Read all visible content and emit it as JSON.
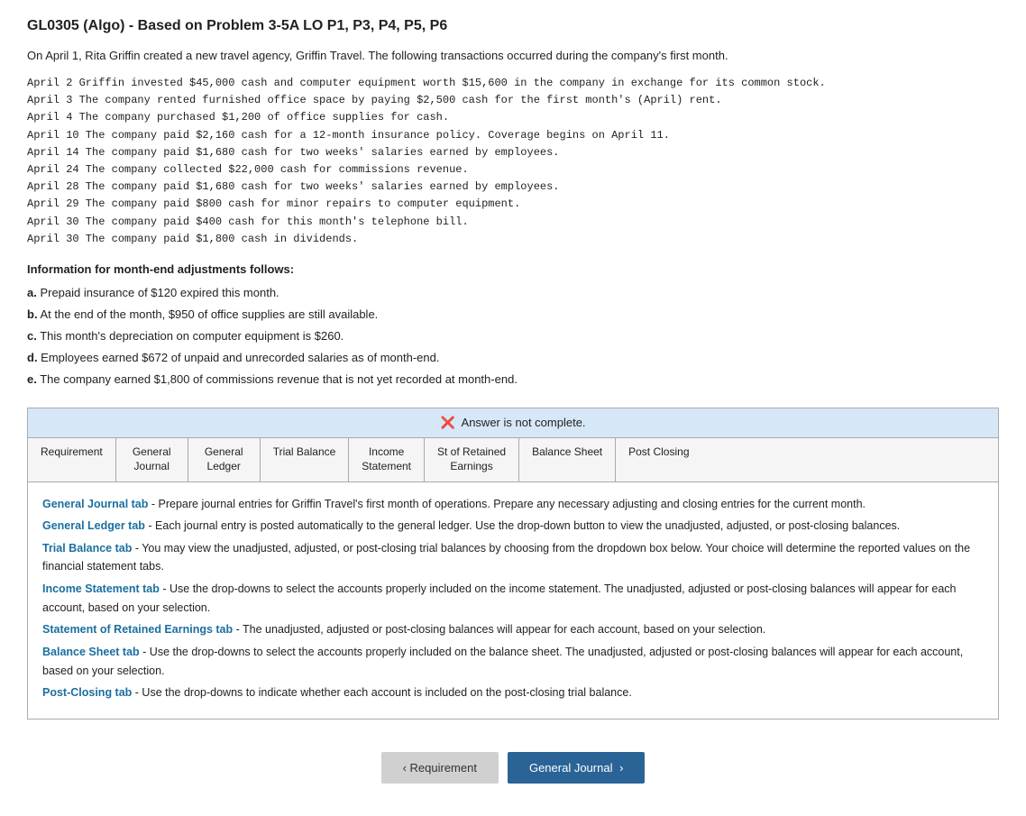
{
  "header": {
    "title": "GL0305 (Algo) - Based on Problem 3-5A LO P1, P3, P4, P5, P6"
  },
  "intro": "On April 1, Rita Griffin created a new travel agency, Griffin Travel. The following transactions occurred during the company's first month.",
  "transactions": [
    " April 2  Griffin invested $45,000 cash and computer equipment worth $15,600 in the company in exchange for its common stock.",
    " April 3  The company rented furnished office space by paying $2,500 cash for the first month's (April) rent.",
    " April 4  The company purchased $1,200 of office supplies for cash.",
    "April 10  The company paid $2,160 cash for a 12-month insurance policy. Coverage begins on April 11.",
    "April 14  The company paid $1,680 cash for two weeks' salaries earned by employees.",
    "April 24  The company collected $22,000 cash for commissions revenue.",
    "April 28  The company paid $1,680 cash for two weeks' salaries earned by employees.",
    "April 29  The company paid $800 cash for minor repairs to computer equipment.",
    "April 30  The company paid $400 cash for this month's telephone bill.",
    "April 30  The company paid $1,800 cash in dividends."
  ],
  "adjustments_title": "Information for month-end adjustments follows:",
  "adjustments": [
    {
      "label": "a.",
      "text": " Prepaid insurance of $120 expired this month.",
      "bold": false
    },
    {
      "label": "b.",
      "text": " At the end of the month, $950 of office supplies are still available.",
      "bold": true
    },
    {
      "label": "c.",
      "text": " This month's depreciation on computer equipment is $260.",
      "bold": false
    },
    {
      "label": "d.",
      "text": " Employees earned $672 of unpaid and unrecorded salaries as of month-end.",
      "bold": false
    },
    {
      "label": "e.",
      "text": " The company earned $1,800 of commissions revenue that is not yet recorded at month-end.",
      "bold": false
    }
  ],
  "answer_status": "Answer is not complete.",
  "tabs": [
    {
      "id": "requirement",
      "label": "Requirement"
    },
    {
      "id": "general-journal",
      "label": "General\nJournal"
    },
    {
      "id": "general-ledger",
      "label": "General\nLedger"
    },
    {
      "id": "trial-balance",
      "label": "Trial Balance"
    },
    {
      "id": "income-statement",
      "label": "Income\nStatement"
    },
    {
      "id": "st-retained-earnings",
      "label": "St of Retained\nEarnings"
    },
    {
      "id": "balance-sheet",
      "label": "Balance Sheet"
    },
    {
      "id": "post-closing",
      "label": "Post Closing"
    }
  ],
  "descriptions": [
    {
      "link_text": "General Journal tab",
      "body": " - Prepare journal entries for Griffin Travel's first month of operations.  Prepare any necessary adjusting and closing entries for the current month."
    },
    {
      "link_text": "General Ledger tab",
      "body": " - Each journal entry is posted automatically to the general ledger. Use the drop-down button to view the unadjusted, adjusted, or post-closing balances."
    },
    {
      "link_text": "Trial Balance tab",
      "body": " - You may view the unadjusted, adjusted, or post-closing trial balances by choosing from the dropdown box below. Your choice will determine the reported values on the financial statement tabs."
    },
    {
      "link_text": "Income Statement tab",
      "body": " - Use the drop-downs to select the accounts properly included on the income statement. The unadjusted, adjusted or post-closing balances will appear for each account, based on your selection."
    },
    {
      "link_text": "Statement of Retained Earnings tab",
      "body": " - The unadjusted, adjusted or post-closing balances will appear for each account, based on your selection."
    },
    {
      "link_text": "Balance Sheet tab",
      "body": " - Use the drop-downs to select the accounts properly included on the balance sheet.  The unadjusted, adjusted or post-closing balances will appear for each account, based on your selection."
    },
    {
      "link_text": "Post-Closing tab",
      "body": " - Use the drop-downs to indicate whether each account is included on the post-closing trial balance."
    }
  ],
  "nav": {
    "prev_label": "Requirement",
    "next_label": "General Journal"
  }
}
